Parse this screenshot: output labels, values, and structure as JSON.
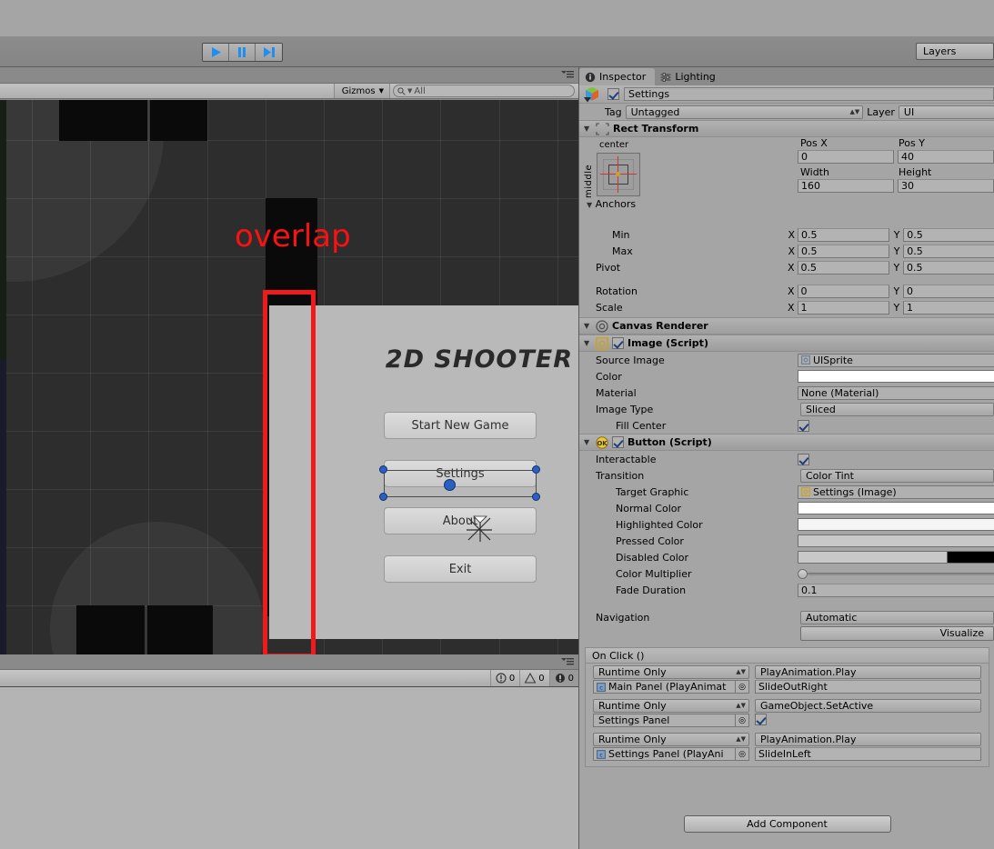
{
  "toolbar": {
    "play_icon": "play-icon",
    "pause_icon": "pause-icon",
    "step_icon": "step-icon",
    "layers_label": "Layers"
  },
  "scene_view": {
    "gizmos_label": "Gizmos",
    "search_placeholder": "All",
    "search_icon": "search-icon",
    "annotation": "overlap",
    "annotation_color": "#fa1111",
    "selection_box_color": "#f01a1a",
    "game_menu": {
      "title": "2D SHOOTER",
      "buttons": [
        {
          "label": "Start New Game",
          "selected": false
        },
        {
          "label": "Settings",
          "selected": true
        },
        {
          "label": "About",
          "selected": false
        },
        {
          "label": "Exit",
          "selected": false
        }
      ]
    }
  },
  "console": {
    "error_count": "0",
    "warning_count": "0",
    "info_count": "0",
    "error_icon": "error-circle-icon",
    "warning_icon": "warning-triangle-icon",
    "info_icon": "info-circle-icon"
  },
  "inspector": {
    "tabs": [
      {
        "label": "Inspector",
        "icon": "info-icon",
        "active": true
      },
      {
        "label": "Lighting",
        "icon": "lighting-icon",
        "active": false
      }
    ],
    "object": {
      "name": "Settings",
      "enabled": true,
      "tag_label": "Tag",
      "tag_value": "Untagged",
      "layer_label": "Layer",
      "layer_value": "UI"
    },
    "rect_transform": {
      "title": "Rect Transform",
      "anchor_preset_h": "center",
      "anchor_preset_v": "middle",
      "pos_x_label": "Pos X",
      "pos_x": "0",
      "pos_y_label": "Pos Y",
      "pos_y": "40",
      "width_label": "Width",
      "width": "160",
      "height_label": "Height",
      "height": "30",
      "anchors_label": "Anchors",
      "min_label": "Min",
      "min_x": "0.5",
      "min_y": "0.5",
      "max_label": "Max",
      "max_x": "0.5",
      "max_y": "0.5",
      "pivot_label": "Pivot",
      "pivot_x": "0.5",
      "pivot_y": "0.5",
      "rotation_label": "Rotation",
      "rot_x": "0",
      "rot_y": "0",
      "scale_label": "Scale",
      "scale_x": "1",
      "scale_y": "1"
    },
    "canvas_renderer": {
      "title": "Canvas Renderer"
    },
    "image_script": {
      "title": "Image (Script)",
      "enabled": true,
      "source_image_label": "Source Image",
      "source_image_value": "UISprite",
      "color_label": "Color",
      "color_value": "#ffffff",
      "material_label": "Material",
      "material_value": "None (Material)",
      "image_type_label": "Image Type",
      "image_type_value": "Sliced",
      "fill_center_label": "Fill Center",
      "fill_center": true
    },
    "button_script": {
      "title": "Button (Script)",
      "enabled": true,
      "interactable_label": "Interactable",
      "interactable": true,
      "transition_label": "Transition",
      "transition_value": "Color Tint",
      "target_graphic_label": "Target Graphic",
      "target_graphic_value": "Settings (Image)",
      "normal_color_label": "Normal Color",
      "normal_color": "#ffffff",
      "highlighted_color_label": "Highlighted Color",
      "highlighted_color": "#f5f5f5",
      "pressed_color_label": "Pressed Color",
      "pressed_color": "#c8c8c8",
      "disabled_color_label": "Disabled Color",
      "disabled_color": "#c8c8c8",
      "color_multiplier_label": "Color Multiplier",
      "fade_duration_label": "Fade Duration",
      "fade_duration": "0.1",
      "navigation_label": "Navigation",
      "navigation_value": "Automatic",
      "visualize_label": "Visualize"
    },
    "on_click": {
      "title": "On Click ()",
      "events": [
        {
          "mode": "Runtime Only",
          "function": "PlayAnimation.Play",
          "object": "Main Panel (PlayAnimat",
          "object_icon": "script-icon",
          "arg_type": "string",
          "arg_value": "SlideOutRight"
        },
        {
          "mode": "Runtime Only",
          "function": "GameObject.SetActive",
          "object": "Settings Panel",
          "object_icon": "",
          "arg_type": "bool",
          "arg_value": true
        },
        {
          "mode": "Runtime Only",
          "function": "PlayAnimation.Play",
          "object": "Settings Panel (PlayAni",
          "object_icon": "script-icon",
          "arg_type": "string",
          "arg_value": "SlideInLeft"
        }
      ]
    },
    "add_component_label": "Add Component"
  }
}
